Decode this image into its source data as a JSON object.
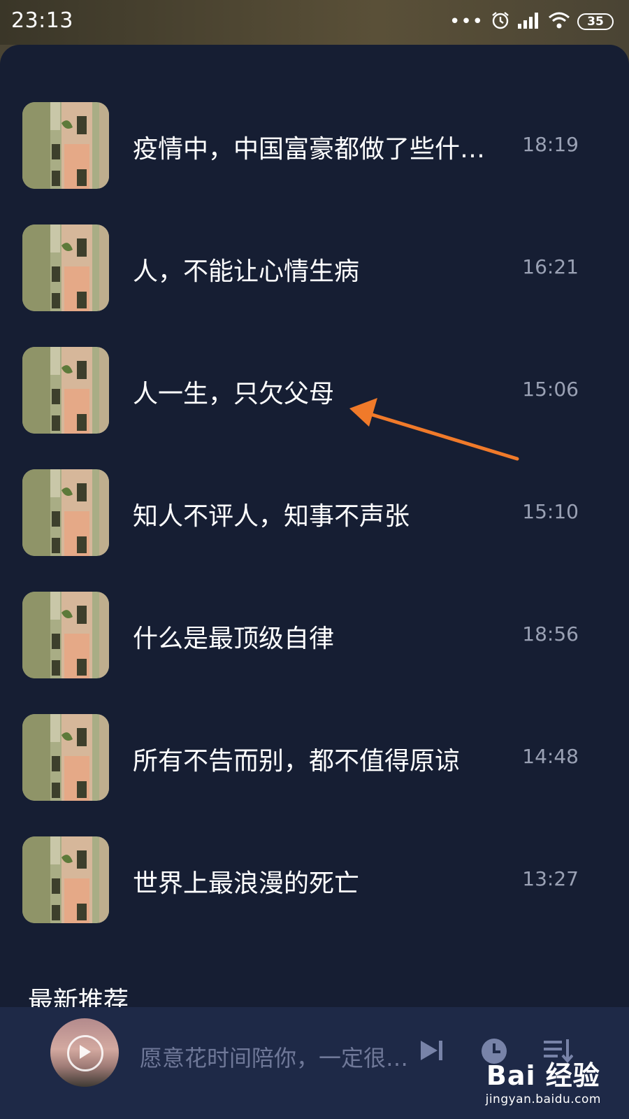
{
  "status_bar": {
    "time": "23:13",
    "battery": "35",
    "icons": [
      "more-dots-icon",
      "alarm-icon",
      "signal-icon",
      "wifi-icon",
      "battery-icon"
    ]
  },
  "playlist": {
    "items": [
      {
        "title": "疫情中，中国富豪都做了些什…",
        "time": "18:19"
      },
      {
        "title": "人，不能让心情生病",
        "time": "16:21"
      },
      {
        "title": "人一生，只欠父母",
        "time": "15:06"
      },
      {
        "title": "知人不评人，知事不声张",
        "time": "15:10"
      },
      {
        "title": "什么是最顶级自律",
        "time": "18:56"
      },
      {
        "title": "所有不告而别，都不值得原谅",
        "time": "14:48"
      },
      {
        "title": "世界上最浪漫的死亡",
        "time": "13:27"
      }
    ]
  },
  "section": {
    "title": "最新推荐"
  },
  "player": {
    "now_playing": "愿意花时间陪你，一定很…",
    "icons": [
      "play-icon",
      "next-icon",
      "timer-icon",
      "playlist-icon"
    ]
  },
  "annotation": {
    "color": "#f07a2a"
  },
  "watermark": {
    "logo": "Bai 经验",
    "url": "jingyan.baidu.com"
  },
  "colors": {
    "background": "#161e33",
    "player_bar": "#1e2947",
    "muted_text": "#9aa1b4"
  }
}
